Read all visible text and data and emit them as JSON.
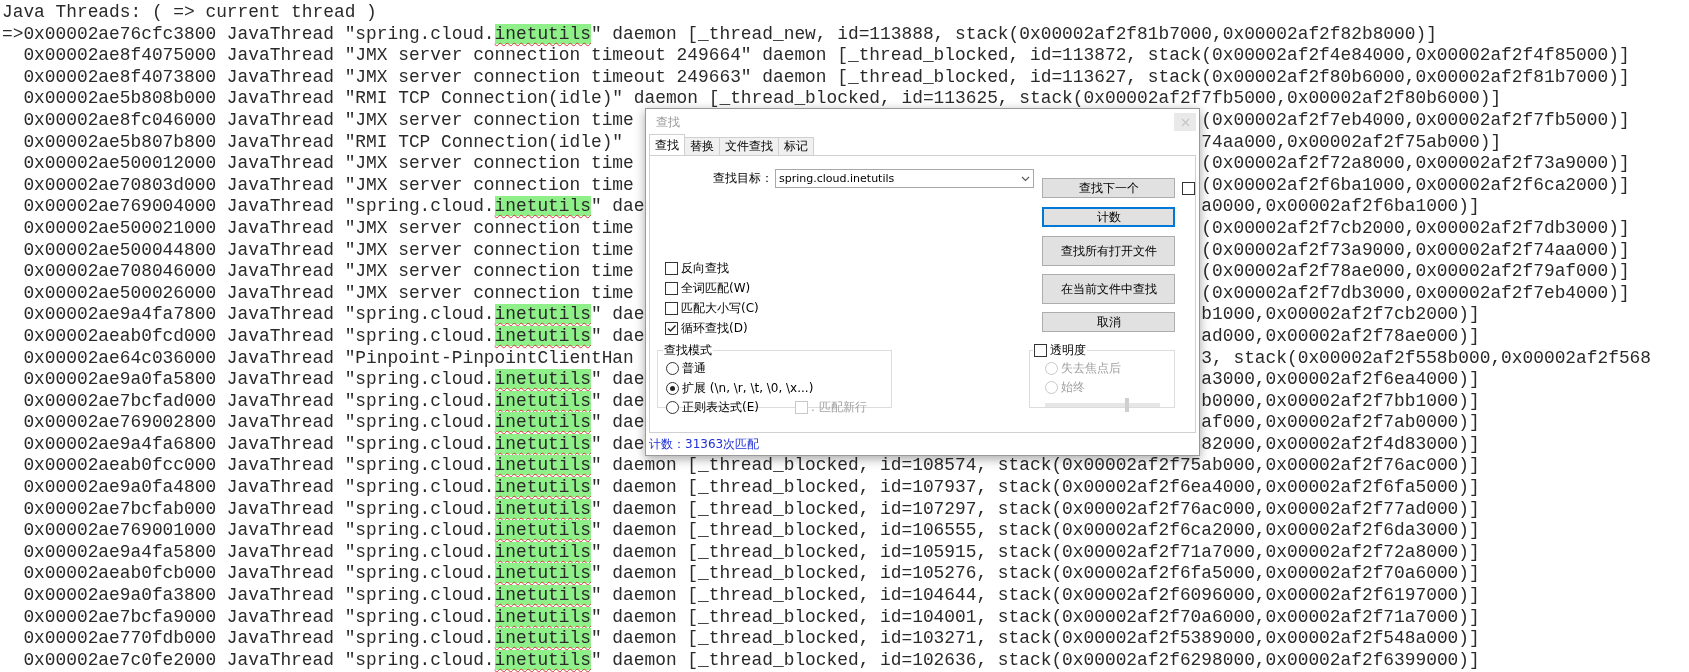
{
  "editor": {
    "lines": [
      {
        "parts": [
          {
            "text": "Java Threads: ( => current thread )",
            "match": false
          }
        ]
      },
      {
        "parts": [
          {
            "text": "=>0x00002ae76cfc3800 JavaThread \"spring.cloud.",
            "match": false
          },
          {
            "text": "inetutils",
            "match": true
          },
          {
            "text": "\" daemon [_thread_new, id=113888, stack(0x00002af2f81b7000,0x00002af2f82b8000)]",
            "match": false
          }
        ]
      },
      {
        "parts": [
          {
            "text": "  0x00002ae8f4075000 JavaThread \"JMX server connection timeout 249664\" daemon [_thread_blocked, id=113872, stack(0x00002af2f4e84000,0x00002af2f4f85000)]",
            "match": false
          }
        ]
      },
      {
        "parts": [
          {
            "text": "  0x00002ae8f4073800 JavaThread \"JMX server connection timeout 249663\" daemon [_thread_blocked, id=113627, stack(0x00002af2f80b6000,0x00002af2f81b7000)]",
            "match": false
          }
        ]
      },
      {
        "parts": [
          {
            "text": "  0x00002ae5b808b000 JavaThread \"RMI TCP Connection(idle)\" daemon [_thread_blocked, id=113625, stack(0x00002af2f7fb5000,0x00002af2f80b6000)]",
            "match": false
          }
        ]
      },
      {
        "parts": [
          {
            "text": "  0x00002ae8fc046000 JavaThread \"JMX server connection time",
            "match": false
          }
        ],
        "right": "(0x00002af2f7eb4000,0x00002af2f7fb5000)]"
      },
      {
        "parts": [
          {
            "text": "  0x00002ae5b807b800 JavaThread \"RMI TCP Connection(idle)\"",
            "match": false
          }
        ],
        "right": "74aa000,0x00002af2f75ab000)]"
      },
      {
        "parts": [
          {
            "text": "  0x00002ae500012000 JavaThread \"JMX server connection time",
            "match": false
          }
        ],
        "right": "(0x00002af2f72a8000,0x00002af2f73a9000)]"
      },
      {
        "parts": [
          {
            "text": "  0x00002ae70803d000 JavaThread \"JMX server connection time",
            "match": false
          }
        ],
        "right": "(0x00002af2f6ba1000,0x00002af2f6ca2000)]"
      },
      {
        "parts": [
          {
            "text": "  0x00002ae769004000 JavaThread \"spring.cloud.",
            "match": false
          },
          {
            "text": "inetutils",
            "match": true
          },
          {
            "text": "\" dae",
            "match": false
          }
        ],
        "right": "a0000,0x00002af2f6ba1000)]"
      },
      {
        "parts": [
          {
            "text": "  0x00002ae500021000 JavaThread \"JMX server connection time",
            "match": false
          }
        ],
        "right": "(0x00002af2f7cb2000,0x00002af2f7db3000)]"
      },
      {
        "parts": [
          {
            "text": "  0x00002ae500044800 JavaThread \"JMX server connection time",
            "match": false
          }
        ],
        "right": "(0x00002af2f73a9000,0x00002af2f74aa000)]"
      },
      {
        "parts": [
          {
            "text": "  0x00002ae708046000 JavaThread \"JMX server connection time",
            "match": false
          }
        ],
        "right": "(0x00002af2f78ae000,0x00002af2f79af000)]"
      },
      {
        "parts": [
          {
            "text": "  0x00002ae500026000 JavaThread \"JMX server connection time",
            "match": false
          }
        ],
        "right": "(0x00002af2f7db3000,0x00002af2f7eb4000)]"
      },
      {
        "parts": [
          {
            "text": "  0x00002ae9a4fa7800 JavaThread \"spring.cloud.",
            "match": false
          },
          {
            "text": "inetutils",
            "match": true
          },
          {
            "text": "\" dae",
            "match": false
          }
        ],
        "right": "b1000,0x00002af2f7cb2000)]"
      },
      {
        "parts": [
          {
            "text": "  0x00002aeab0fcd000 JavaThread \"spring.cloud.",
            "match": false
          },
          {
            "text": "inetutils",
            "match": true
          },
          {
            "text": "\" dae",
            "match": false
          }
        ],
        "right": "ad000,0x00002af2f78ae000)]"
      },
      {
        "parts": [
          {
            "text": "  0x00002ae64c036000 JavaThread \"Pinpoint-PinpointClientHan",
            "match": false
          }
        ],
        "right": "3, stack(0x00002af2f558b000,0x00002af2f568"
      },
      {
        "parts": [
          {
            "text": "  0x00002ae9a0fa5800 JavaThread \"spring.cloud.",
            "match": false
          },
          {
            "text": "inetutils",
            "match": true
          },
          {
            "text": "\" dae",
            "match": false
          }
        ],
        "right": "a3000,0x00002af2f6ea4000)]"
      },
      {
        "parts": [
          {
            "text": "  0x00002ae7bcfad000 JavaThread \"spring.cloud.",
            "match": false
          },
          {
            "text": "inetutils",
            "match": true
          },
          {
            "text": "\" dae",
            "match": false
          }
        ],
        "right": "b0000,0x00002af2f7bb1000)]"
      },
      {
        "parts": [
          {
            "text": "  0x00002ae769002800 JavaThread \"spring.cloud.",
            "match": false
          },
          {
            "text": "inetutils",
            "match": true
          },
          {
            "text": "\" dae",
            "match": false
          }
        ],
        "right": "af000,0x00002af2f7ab0000)]"
      },
      {
        "parts": [
          {
            "text": "  0x00002ae9a4fa6800 JavaThread \"spring.cloud.",
            "match": false
          },
          {
            "text": "inetutils",
            "match": true
          },
          {
            "text": "\" dae",
            "match": false
          }
        ],
        "right": "82000,0x00002af2f4d83000)]"
      },
      {
        "parts": [
          {
            "text": "  0x00002aeab0fcc000 JavaThread \"spring.cloud.",
            "match": false
          },
          {
            "text": "inetutils",
            "match": true
          },
          {
            "text": "\" daemon [_thread_blocked, id=108574, stack(0x00002af2f75ab000,0x00002af2f76ac000)]",
            "match": false
          }
        ]
      },
      {
        "parts": [
          {
            "text": "  0x00002ae9a0fa4800 JavaThread \"spring.cloud.",
            "match": false
          },
          {
            "text": "inetutils",
            "match": true
          },
          {
            "text": "\" daemon [_thread_blocked, id=107937, stack(0x00002af2f6ea4000,0x00002af2f6fa5000)]",
            "match": false
          }
        ]
      },
      {
        "parts": [
          {
            "text": "  0x00002ae7bcfab000 JavaThread \"spring.cloud.",
            "match": false
          },
          {
            "text": "inetutils",
            "match": true
          },
          {
            "text": "\" daemon [_thread_blocked, id=107297, stack(0x00002af2f76ac000,0x00002af2f77ad000)]",
            "match": false
          }
        ]
      },
      {
        "parts": [
          {
            "text": "  0x00002ae769001000 JavaThread \"spring.cloud.",
            "match": false
          },
          {
            "text": "inetutils",
            "match": true
          },
          {
            "text": "\" daemon [_thread_blocked, id=106555, stack(0x00002af2f6ca2000,0x00002af2f6da3000)]",
            "match": false
          }
        ]
      },
      {
        "parts": [
          {
            "text": "  0x00002ae9a4fa5800 JavaThread \"spring.cloud.",
            "match": false
          },
          {
            "text": "inetutils",
            "match": true
          },
          {
            "text": "\" daemon [_thread_blocked, id=105915, stack(0x00002af2f71a7000,0x00002af2f72a8000)]",
            "match": false
          }
        ]
      },
      {
        "parts": [
          {
            "text": "  0x00002aeab0fcb000 JavaThread \"spring.cloud.",
            "match": false
          },
          {
            "text": "inetutils",
            "match": true
          },
          {
            "text": "\" daemon [_thread_blocked, id=105276, stack(0x00002af2f6fa5000,0x00002af2f70a6000)]",
            "match": false
          }
        ]
      },
      {
        "parts": [
          {
            "text": "  0x00002ae9a0fa3800 JavaThread \"spring.cloud.",
            "match": false
          },
          {
            "text": "inetutils",
            "match": true
          },
          {
            "text": "\" daemon [_thread_blocked, id=104644, stack(0x00002af2f6096000,0x00002af2f6197000)]",
            "match": false
          }
        ]
      },
      {
        "parts": [
          {
            "text": "  0x00002ae7bcfa9000 JavaThread \"spring.cloud.",
            "match": false
          },
          {
            "text": "inetutils",
            "match": true
          },
          {
            "text": "\" daemon [_thread_blocked, id=104001, stack(0x00002af2f70a6000,0x00002af2f71a7000)]",
            "match": false
          }
        ]
      },
      {
        "parts": [
          {
            "text": "  0x00002ae770fdb000 JavaThread \"spring.cloud.",
            "match": false
          },
          {
            "text": "inetutils",
            "match": true
          },
          {
            "text": "\" daemon [_thread_blocked, id=103271, stack(0x00002af2f5389000,0x00002af2f548a000)]",
            "match": false
          }
        ]
      },
      {
        "parts": [
          {
            "text": "  0x00002ae7c0fe2000 JavaThread \"spring.cloud.",
            "match": false
          },
          {
            "text": "inetutils",
            "match": true
          },
          {
            "text": "\" daemon [_thread_blocked, id=102636, stack(0x00002af2f6298000,0x00002af2f6399000)]",
            "match": false
          }
        ]
      }
    ]
  },
  "find_dialog": {
    "title": "查找",
    "tabs": [
      {
        "label": "查找",
        "selected": true
      },
      {
        "label": "替换",
        "selected": false
      },
      {
        "label": "文件查找",
        "selected": false
      },
      {
        "label": "标记",
        "selected": false
      }
    ],
    "find_label": "查找目标：",
    "find_value": "spring.cloud.inetutils",
    "buttons": [
      {
        "label": "查找下一个",
        "focused": false
      },
      {
        "label": "计数",
        "focused": true
      },
      {
        "label": "查找所有打开文件",
        "focused": false
      },
      {
        "label": "在当前文件中查找",
        "focused": false
      },
      {
        "label": "取消",
        "focused": false
      }
    ],
    "find_next_toggle": {
      "checked": false
    },
    "options": [
      {
        "label": "反向查找",
        "checked": false
      },
      {
        "label": "全词匹配(W)",
        "checked": false
      },
      {
        "label": "匹配大小写(C)",
        "checked": false
      },
      {
        "label": "循环查找(D)",
        "checked": true
      }
    ],
    "search_mode": {
      "title": "查找模式",
      "options": [
        {
          "label": "普通",
          "selected": false
        },
        {
          "label": "扩展 (\\n, \\r, \\t, \\0, \\x...)",
          "selected": true
        },
        {
          "label": "正则表达式(E)",
          "selected": false
        }
      ],
      "dot_newline": {
        "label": ". 匹配新行",
        "checked": false,
        "disabled": true
      }
    },
    "transparency": {
      "label": "透明度",
      "checked": false,
      "options": [
        {
          "label": "失去焦点后",
          "selected": false,
          "disabled": true
        },
        {
          "label": "始终",
          "selected": false,
          "disabled": true
        }
      ],
      "slider": {
        "level": 0.71,
        "disabled": true
      }
    },
    "status": "计数：31363次匹配"
  }
}
